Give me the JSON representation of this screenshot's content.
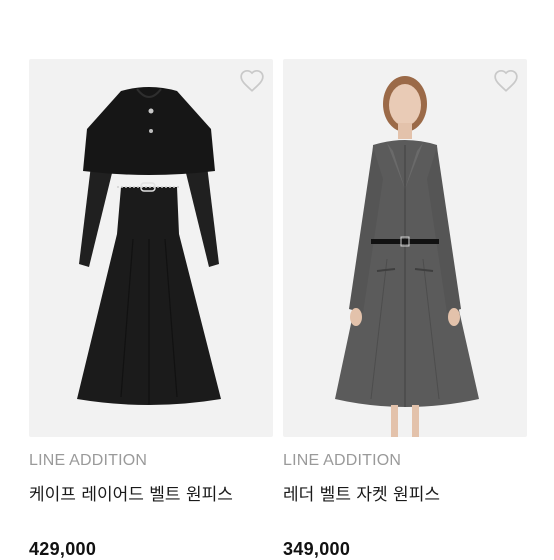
{
  "products": [
    {
      "brand": "LINE ADDITION",
      "name": "케이프 레이어드 벨트 원피스",
      "price": "429,000",
      "image": "black cape layered belted dress",
      "favorite_icon": "heart-outline-icon"
    },
    {
      "brand": "LINE ADDITION",
      "name": "레더 벨트 자켓 원피스",
      "price": "349,000",
      "image": "grey belted jacket dress on model",
      "favorite_icon": "heart-outline-icon"
    }
  ]
}
